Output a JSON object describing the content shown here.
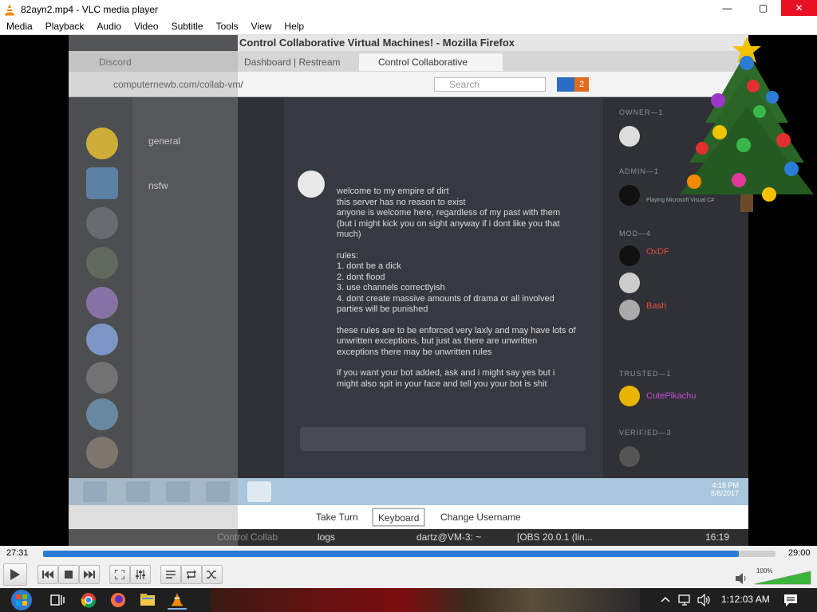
{
  "window": {
    "title": "82ayn2.mp4 - VLC media player"
  },
  "menu": {
    "items": [
      "Media",
      "Playback",
      "Audio",
      "Video",
      "Subtitle",
      "Tools",
      "View",
      "Help"
    ]
  },
  "video": {
    "firefox_title": "Control Collaborative Virtual Machines! - Mozilla Firefox",
    "tabs": [
      "Discord",
      "Dashboard | Restream",
      "Control Collaborative"
    ],
    "url": "computernewb.com/collab-vm/",
    "search_placeholder": "Search",
    "mail_count": "2",
    "channels": [
      "general",
      "nsfw"
    ],
    "message": {
      "lines": [
        "welcome to my empire of dirt",
        "this server has no reason to exist",
        "anyone is welcome here, regardless of my past with them (but i might kick you on sight anyway if i dont like you that much)",
        "rules:",
        "1. dont be a dick",
        "2. dont flood",
        "3. use channels correctlyish",
        "4. dont create massive amounts of drama or all involved parties will be punished",
        "these rules are to be enforced very laxly and may have lots of unwritten exceptions, but just as there are unwritten exceptions there may be unwritten rules",
        "if you want your bot added, ask and i might say yes but i might also spit in your face and tell you your bot is shit"
      ]
    },
    "members": {
      "roles": [
        "OWNER—1",
        "ADMIN—1",
        "MOD—4",
        "TRUSTED—1",
        "VERIFIED—3"
      ],
      "named": [
        {
          "name": "OxDF",
          "color": "#e04b3e"
        },
        {
          "name": "Bash",
          "color": "#e04b3e"
        },
        {
          "name": "CutePikachu",
          "color": "#c54ad8"
        },
        {
          "name": "Playing Microsoft Visual C#",
          "color": "#9aa"
        }
      ]
    },
    "win7_time": "4:18 PM",
    "win7_date": "8/8/2017",
    "remote_buttons": [
      "Take Turn",
      "Keyboard",
      "Change Username"
    ],
    "linux_panel": {
      "items": [
        "Control Collab",
        "logs",
        "dartz@VM-3: ~",
        "[OBS 20.0.1 (lin..."
      ],
      "time": "16:19"
    }
  },
  "player": {
    "elapsed": "27:31",
    "total": "29:00",
    "progress": 0.95,
    "volume_percent": "100%",
    "volume": 1.0
  },
  "taskbar": {
    "clock": "1:12:03 AM"
  },
  "colors": {
    "vlc_orange": "#f48a00",
    "seek_blue": "#2a7cd6",
    "close_red": "#e81123"
  }
}
